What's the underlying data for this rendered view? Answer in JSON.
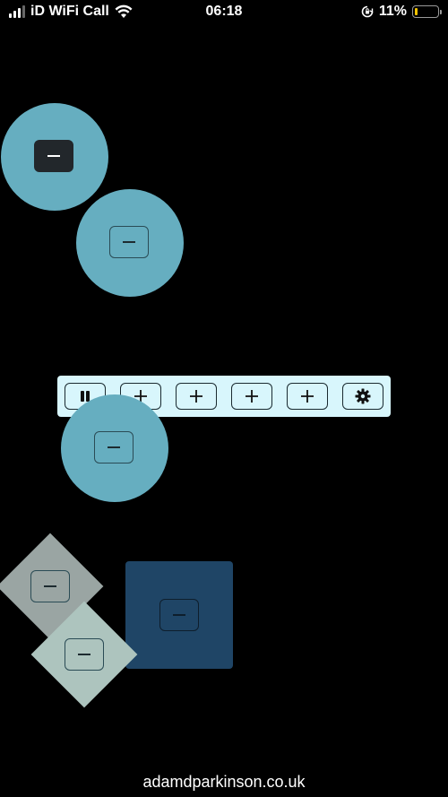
{
  "status_bar": {
    "carrier": "iD WiFi Call",
    "time": "06:18",
    "battery": "11%",
    "battery_level": 0.11,
    "battery_color": "#f4c400"
  },
  "colors": {
    "background": "#000000",
    "circle": "#66aec0",
    "toolbar": "#d8f6fc",
    "square": "#1f4566",
    "diamond_grey": "#9aa5a3",
    "diamond_light": "#adc4be"
  },
  "shapes": [
    {
      "kind": "circle",
      "button": "minus",
      "selected": true
    },
    {
      "kind": "circle",
      "button": "minus"
    },
    {
      "kind": "circle",
      "button": "minus"
    },
    {
      "kind": "diamond",
      "button": "minus"
    },
    {
      "kind": "diamond",
      "button": "minus"
    },
    {
      "kind": "square",
      "button": "minus"
    }
  ],
  "toolbar": {
    "buttons": [
      {
        "icon": "pause-icon"
      },
      {
        "icon": "plus-icon"
      },
      {
        "icon": "plus-icon"
      },
      {
        "icon": "plus-icon"
      },
      {
        "icon": "plus-icon"
      },
      {
        "icon": "gear-icon"
      }
    ]
  },
  "footer": {
    "text": "adamdparkinson.co.uk"
  }
}
